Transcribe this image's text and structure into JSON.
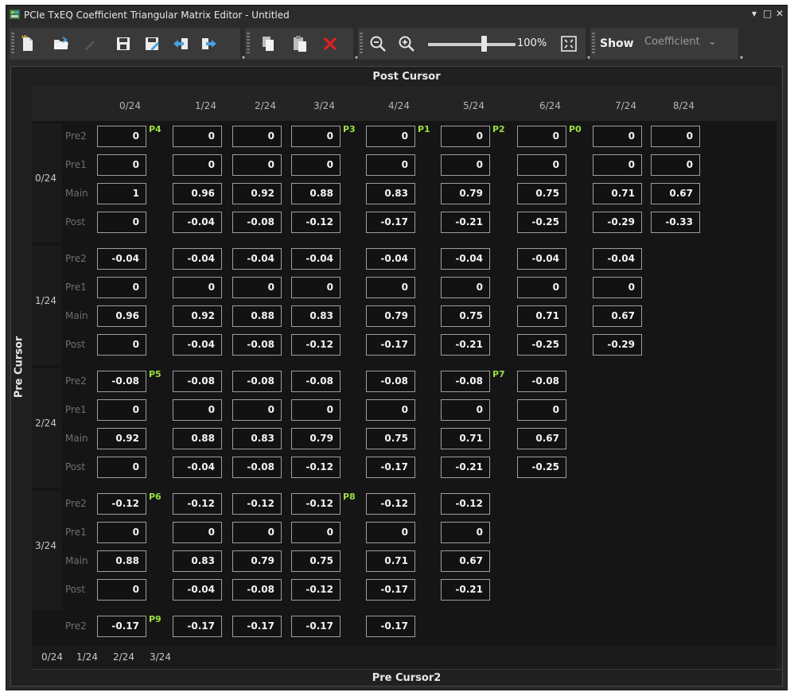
{
  "window": {
    "title": "PCIe TxEQ Coefficient Triangular Matrix Editor - Untitled",
    "controls": [
      "▾",
      "□",
      "✕"
    ]
  },
  "toolbar": {
    "zoom_value": "100%",
    "zoom_level": 0.64,
    "show_label": "Show",
    "show_value": "Coefficient",
    "buttons": [
      "new-icon",
      "open-icon",
      "edit-icon",
      "save-icon",
      "save-as-icon",
      "import-icon",
      "export-icon",
      "copy-icon",
      "paste-icon",
      "delete-icon",
      "zoom-out-icon",
      "zoom-in-icon",
      "fit-icon"
    ]
  },
  "headers": {
    "post_cursor": "Post Cursor",
    "pre_cursor": "Pre Cursor",
    "pre_cursor2": "Pre Cursor2"
  },
  "columns": [
    "0/24",
    "1/24",
    "2/24",
    "3/24",
    "4/24",
    "5/24",
    "6/24",
    "7/24",
    "8/24"
  ],
  "row_labels": [
    "Pre2",
    "Pre1",
    "Main",
    "Post"
  ],
  "groups": [
    {
      "label": "0/24",
      "rows": [
        [
          "0",
          "0",
          "0",
          "0",
          "0",
          "0",
          "0",
          "0",
          "0"
        ],
        [
          "0",
          "0",
          "0",
          "0",
          "0",
          "0",
          "0",
          "0",
          "0"
        ],
        [
          "1",
          "0.96",
          "0.92",
          "0.88",
          "0.83",
          "0.79",
          "0.75",
          "0.71",
          "0.67"
        ],
        [
          "0",
          "-0.04",
          "-0.08",
          "-0.12",
          "-0.17",
          "-0.21",
          "-0.25",
          "-0.29",
          "-0.33"
        ]
      ]
    },
    {
      "label": "1/24",
      "rows": [
        [
          "-0.04",
          "-0.04",
          "-0.04",
          "-0.04",
          "-0.04",
          "-0.04",
          "-0.04",
          "-0.04"
        ],
        [
          "0",
          "0",
          "0",
          "0",
          "0",
          "0",
          "0",
          "0"
        ],
        [
          "0.96",
          "0.92",
          "0.88",
          "0.83",
          "0.79",
          "0.75",
          "0.71",
          "0.67"
        ],
        [
          "0",
          "-0.04",
          "-0.08",
          "-0.12",
          "-0.17",
          "-0.21",
          "-0.25",
          "-0.29"
        ]
      ]
    },
    {
      "label": "2/24",
      "rows": [
        [
          "-0.08",
          "-0.08",
          "-0.08",
          "-0.08",
          "-0.08",
          "-0.08",
          "-0.08"
        ],
        [
          "0",
          "0",
          "0",
          "0",
          "0",
          "0",
          "0"
        ],
        [
          "0.92",
          "0.88",
          "0.83",
          "0.79",
          "0.75",
          "0.71",
          "0.67"
        ],
        [
          "0",
          "-0.04",
          "-0.08",
          "-0.12",
          "-0.17",
          "-0.21",
          "-0.25"
        ]
      ]
    },
    {
      "label": "3/24",
      "rows": [
        [
          "-0.12",
          "-0.12",
          "-0.12",
          "-0.12",
          "-0.12",
          "-0.12"
        ],
        [
          "0",
          "0",
          "0",
          "0",
          "0",
          "0"
        ],
        [
          "0.88",
          "0.83",
          "0.79",
          "0.75",
          "0.71",
          "0.67"
        ],
        [
          "0",
          "-0.04",
          "-0.08",
          "-0.12",
          "-0.17",
          "-0.21"
        ]
      ]
    },
    {
      "label": "",
      "rows": [
        [
          "-0.17",
          "-0.17",
          "-0.17",
          "-0.17",
          "-0.17"
        ]
      ]
    }
  ],
  "presets": [
    {
      "name": "P4",
      "group": 0,
      "row": 0,
      "col": 0
    },
    {
      "name": "P3",
      "group": 0,
      "row": 0,
      "col": 3
    },
    {
      "name": "P1",
      "group": 0,
      "row": 0,
      "col": 4
    },
    {
      "name": "P2",
      "group": 0,
      "row": 0,
      "col": 5
    },
    {
      "name": "P0",
      "group": 0,
      "row": 0,
      "col": 6
    },
    {
      "name": "P5",
      "group": 2,
      "row": 0,
      "col": 0
    },
    {
      "name": "P7",
      "group": 2,
      "row": 0,
      "col": 5
    },
    {
      "name": "P6",
      "group": 3,
      "row": 0,
      "col": 0
    },
    {
      "name": "P8",
      "group": 3,
      "row": 0,
      "col": 3
    },
    {
      "name": "P9",
      "group": 4,
      "row": 0,
      "col": 0
    }
  ],
  "footer_cols": [
    "0/24",
    "1/24",
    "2/24",
    "3/24"
  ],
  "colors": {
    "preset_tag": "#9be040",
    "delete": "#e02020",
    "accent_blue": "#3aa0e0"
  }
}
